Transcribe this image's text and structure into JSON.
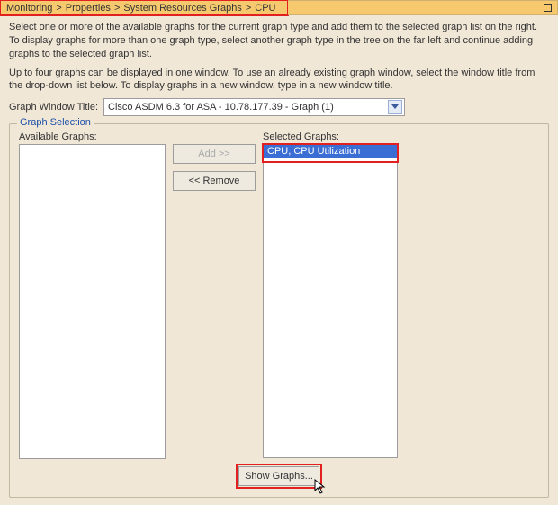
{
  "breadcrumb": {
    "items": [
      "Monitoring",
      "Properties",
      "System Resources Graphs",
      "CPU"
    ],
    "separator": ">"
  },
  "instructions": {
    "p1": "Select one or more of the available graphs for the current graph type and add them to the selected graph list on the right. To display graphs for more than one graph type, select another graph type in the tree on the far left and continue adding graphs to the selected graph list.",
    "p2": "Up to four graphs can be displayed in one window. To use an already existing graph window, select the window title from the drop-down list below. To display graphs in a new window, type in a new window title."
  },
  "graph_window": {
    "label": "Graph Window Title:",
    "value": "Cisco ASDM 6.3 for ASA - 10.78.177.39 - Graph (1)"
  },
  "selection": {
    "legend": "Graph Selection",
    "available_label": "Available Graphs:",
    "selected_label": "Selected Graphs:",
    "available_items": [],
    "selected_items": [
      "CPU, CPU Utilization"
    ],
    "add_label": "Add >>",
    "remove_label": "<< Remove"
  },
  "footer": {
    "show_label": "Show Graphs..."
  }
}
